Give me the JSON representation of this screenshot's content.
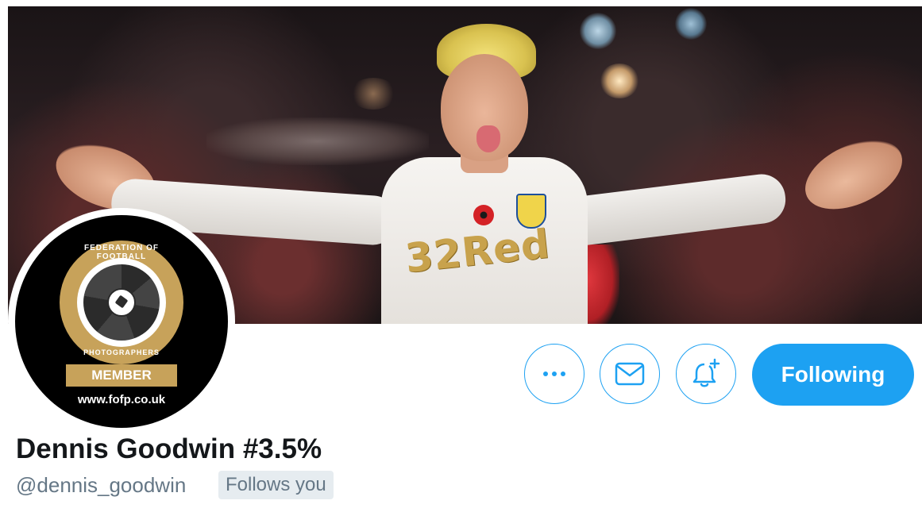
{
  "profile": {
    "display_name": "Dennis Goodwin #3.5%",
    "handle": "@dennis_goodwin",
    "follows_you_label": "Follows you"
  },
  "banner": {
    "sponsor_text": "32Red"
  },
  "avatar": {
    "ring_top_text": "FEDERATION OF FOOTBALL",
    "ring_bottom_text": "PHOTOGRAPHERS",
    "member_label": "MEMBER",
    "url_text": "www.fofp.co.uk"
  },
  "actions": {
    "more_icon": "more-horizontal-icon",
    "message_icon": "envelope-icon",
    "notify_icon": "bell-plus-icon",
    "following_label": "Following"
  },
  "colors": {
    "accent": "#1da1f2",
    "name_text": "#14171a",
    "secondary_text": "#657786",
    "badge_bg": "#e6ecf0",
    "fofp_gold": "#c7a25a"
  }
}
